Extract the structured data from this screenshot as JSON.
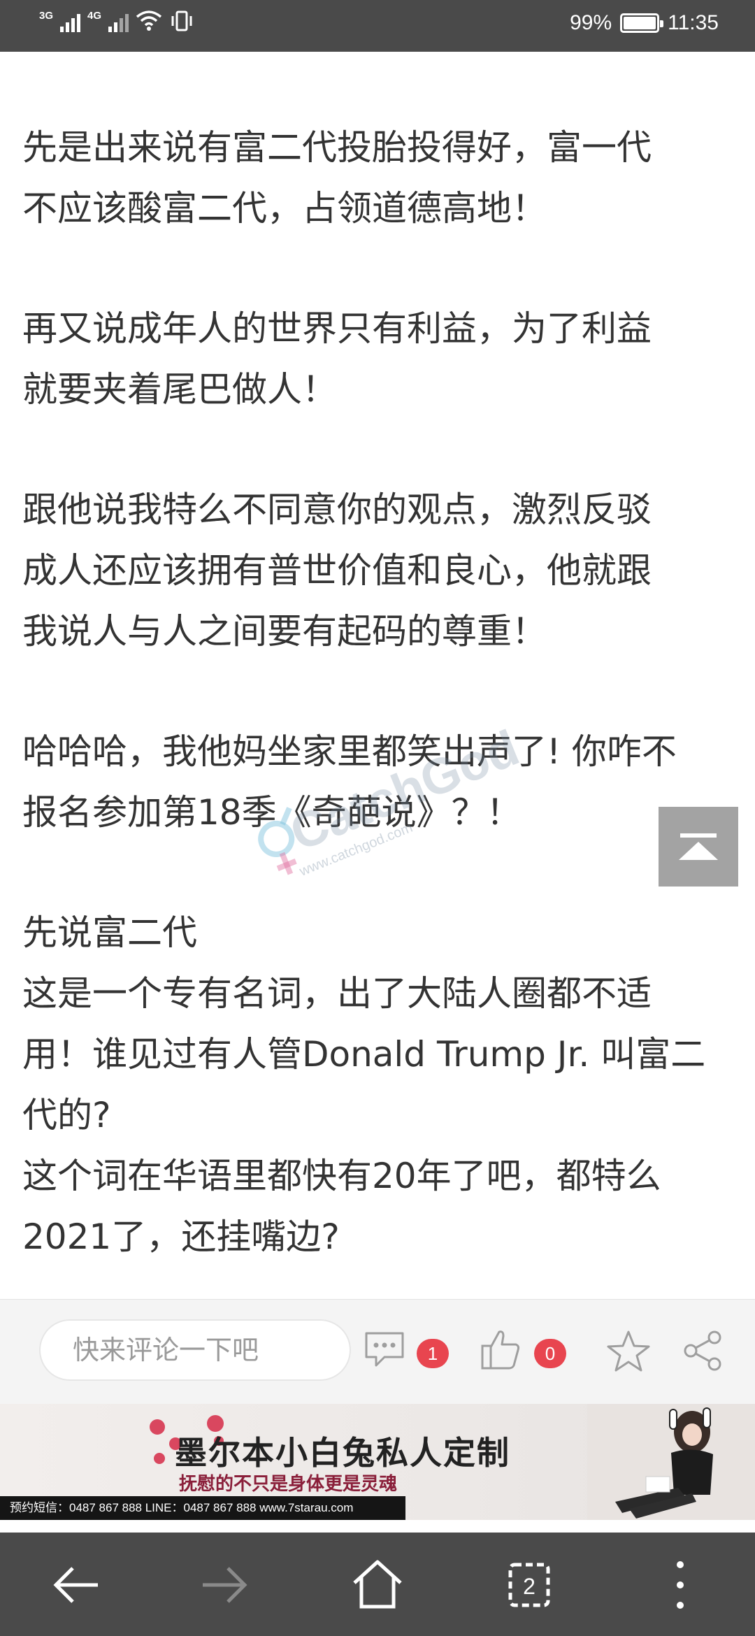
{
  "status_bar": {
    "signal1_label": "3G",
    "signal2_label": "4G",
    "battery_percent": "99%",
    "battery_level": 0.99,
    "time": "11:35"
  },
  "article": {
    "paragraphs": [
      "先是出来说有富二代投胎投得好，富一代\n不应该酸富二代，占领道德高地！",
      "再又说成年人的世界只有利益，为了利益\n就要夹着尾巴做人！",
      "跟他说我特么不同意你的观点，激烈反驳\n成人还应该拥有普世价值和良心，他就跟\n我说人与人之间要有起码的尊重！",
      "哈哈哈，我他妈坐家里都笑出声了! 你咋不\n报名参加第18季《奇葩说》？！",
      "先说富二代\n这是一个专有名词，出了大陆人圈都不适\n用！谁见过有人管Donald Trump Jr. 叫富二\n代的?\n这个词在华语里都快有20年了吧，都特么\n2021了，还挂嘴边?"
    ]
  },
  "watermark": {
    "brand": "CatchGod",
    "url": "www.catchgod.com"
  },
  "comment_bar": {
    "input_placeholder": "快来评论一下吧",
    "comment_count": "1",
    "like_count": "0"
  },
  "ad": {
    "title": "墨尔本小白兔私人定制",
    "subtitle": "抚慰的不只是身体更是灵魂",
    "contact": "预约短信：0487 867 888   LINE：0487 867 888   www.7starau.com"
  },
  "colors": {
    "status_bg": "#4a4a4a",
    "text": "#333333",
    "badge": "#e8454f",
    "nav_bg": "#4a4a4a"
  }
}
